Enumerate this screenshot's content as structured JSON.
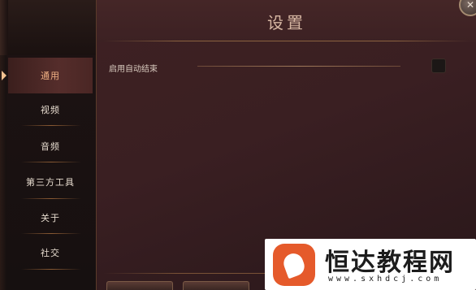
{
  "header": {
    "title": "设置"
  },
  "sidebar": {
    "items": [
      {
        "label": "通用"
      },
      {
        "label": "视频"
      },
      {
        "label": "音频"
      },
      {
        "label": "第三方工具"
      },
      {
        "label": "关于"
      },
      {
        "label": "社交"
      }
    ],
    "active_index": 0
  },
  "settings": {
    "auto_end_label": "启用自动结束",
    "auto_end_checked": false
  },
  "watermark": {
    "name": "恒达教程网",
    "url": "www.sxhdcj.com"
  },
  "colors": {
    "accent": "#f0b083",
    "panel": "#3a1f22",
    "sidebar": "#1c1212",
    "watermark_brand": "#e55a2b"
  },
  "icons": {
    "close": "close-icon",
    "active_marker": "chevron-right-icon"
  }
}
